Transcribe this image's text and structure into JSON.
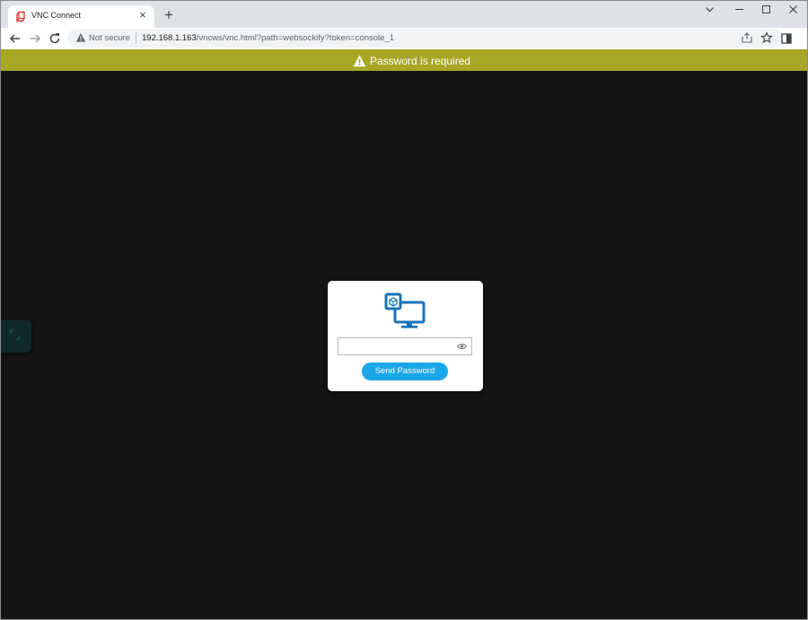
{
  "browser": {
    "tab": {
      "title": "VNC Connect",
      "close_glyph": "×",
      "favicon": "vnc-logo-icon"
    },
    "new_tab_glyph": "+",
    "address_bar": {
      "security_label": "Not secure",
      "url_host": "192.168.1.163",
      "url_path": "/vncws/vnc.html?path=websockify?token=console_1"
    }
  },
  "banner": {
    "message": "Password is required",
    "icon": "warning-icon",
    "background": "#a6a724"
  },
  "dialog": {
    "logo": "vnc-monitor-logo-icon",
    "password_value": "",
    "send_button_label": "Send Password",
    "accent": "#1aa7e8"
  },
  "viewport": {
    "background": "#151515"
  }
}
